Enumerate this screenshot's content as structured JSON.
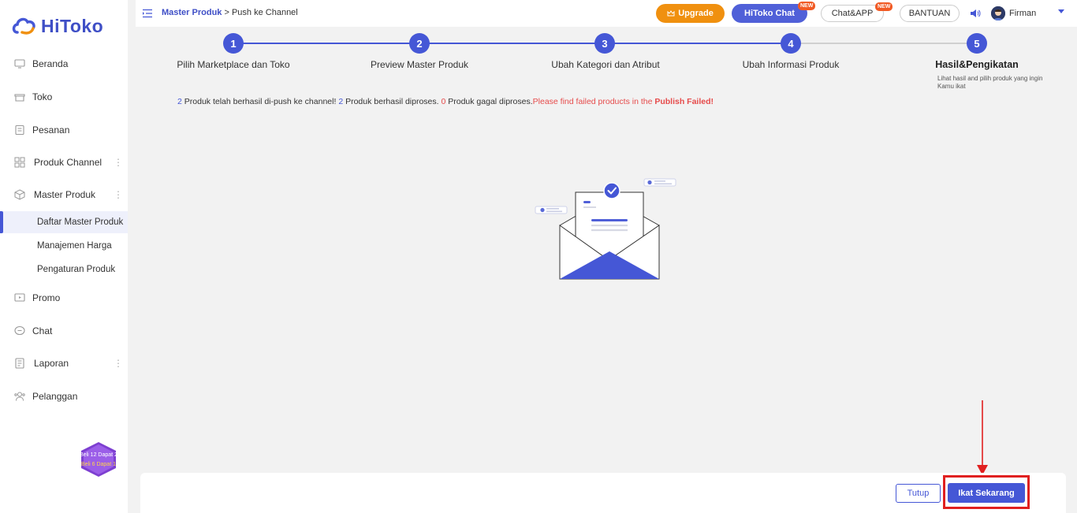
{
  "brand": {
    "name": "HiToko",
    "color": "#3f4fc6"
  },
  "sidebar": {
    "items": [
      {
        "label": "Beranda",
        "icon": "monitor-icon"
      },
      {
        "label": "Toko",
        "icon": "store-icon"
      },
      {
        "label": "Pesanan",
        "icon": "order-icon"
      },
      {
        "label": "Produk Channel",
        "icon": "grid-icon"
      },
      {
        "label": "Master Produk",
        "icon": "box-icon"
      },
      {
        "label": "Promo",
        "icon": "promo-icon"
      },
      {
        "label": "Chat",
        "icon": "chat-icon"
      },
      {
        "label": "Laporan",
        "icon": "report-icon"
      },
      {
        "label": "Pelanggan",
        "icon": "customer-icon"
      }
    ],
    "sub_items": [
      {
        "label": "Daftar Master Produk",
        "active": true
      },
      {
        "label": "Manajemen Harga",
        "active": false
      },
      {
        "label": "Pengaturan Produk",
        "active": false
      }
    ],
    "promo_badge": {
      "line1": "Beli 12 Dapat 2",
      "line2": "Beli 6 Dapat 1"
    }
  },
  "header": {
    "breadcrumb_link": "Master Produk",
    "breadcrumb_sep": " > ",
    "breadcrumb_current": "Push ke Channel",
    "upgrade_label": "Upgrade",
    "hitoko_chat_label": "HiToko Chat",
    "chat_app_label": "Chat&APP",
    "new_badge": "NEW",
    "bantuan_label": "BANTUAN",
    "username": "Firman"
  },
  "steps": [
    {
      "number": "1",
      "label": "Pilih Marketplace dan Toko"
    },
    {
      "number": "2",
      "label": "Preview Master Produk"
    },
    {
      "number": "3",
      "label": "Ubah Kategori dan Atribut"
    },
    {
      "number": "4",
      "label": "Ubah Informasi Produk"
    },
    {
      "number": "5",
      "label": "Hasil&Pengikatan",
      "description": "Lihat hasil and pilih produk yang ingin Kamu ikat"
    }
  ],
  "result": {
    "pushed_count": "2",
    "pushed_text": " Produk telah berhasil di-push ke channel! ",
    "processed_count": "2",
    "processed_text": " Produk berhasil diproses. ",
    "failed_count": "0",
    "failed_text": " Produk gagal diproses.",
    "hint_text": "Please find failed products in the ",
    "hint_bold": "Publish Failed!"
  },
  "footer": {
    "close_label": "Tutup",
    "bind_now_label": "Ikat Sekarang"
  },
  "colors": {
    "primary": "#4557d6",
    "upgrade": "#f0900f",
    "alert": "#e02020",
    "new_badge": "#f15a24"
  }
}
